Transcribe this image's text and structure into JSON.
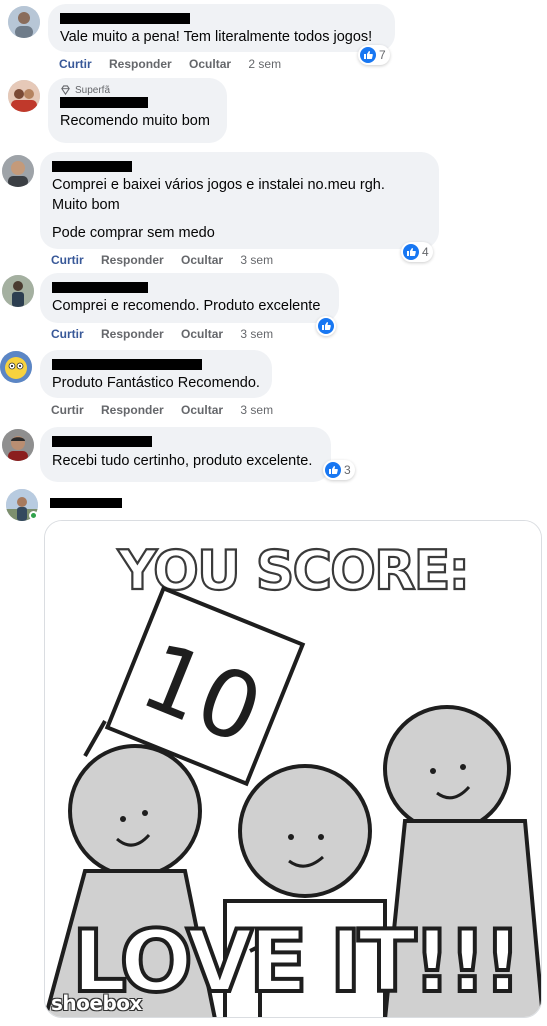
{
  "comments": [
    {
      "text_lines": [
        "Vale muito a pena! Tem literalmente todos jogos!"
      ],
      "actions": [
        "Curtir",
        "Responder",
        "Ocultar"
      ],
      "time": "2 sem",
      "reactions": "7"
    },
    {
      "badge": "Superfã",
      "text_lines": [
        "Recomendo muito bom"
      ]
    },
    {
      "text_lines": [
        "Comprei e baixei vários jogos e instalei no.meu rgh.",
        "Muito bom",
        "Pode comprar sem medo"
      ],
      "actions": [
        "Curtir",
        "Responder",
        "Ocultar"
      ],
      "time": "3 sem",
      "reactions": "4"
    },
    {
      "text_lines": [
        "Comprei e recomendo. Produto excelente"
      ],
      "actions": [
        "Curtir",
        "Responder",
        "Ocultar"
      ],
      "time": "3 sem"
    },
    {
      "text_lines": [
        "Produto Fantástico Recomendo."
      ],
      "actions": [
        "Curtir",
        "Responder",
        "Ocultar"
      ],
      "time": "3 sem"
    },
    {
      "text_lines": [
        "Recebi tudo certinho, produto excelente."
      ],
      "reactions": "3"
    }
  ],
  "gif": {
    "headline": "YOU SCORE:",
    "score": "10",
    "caption": "LOVE IT!!!",
    "watermark": "shoebox"
  },
  "colors": {
    "bubble": "#f0f2f5",
    "link_blue": "#385898",
    "like_blue": "#1877f2",
    "online_green": "#31a24c"
  }
}
